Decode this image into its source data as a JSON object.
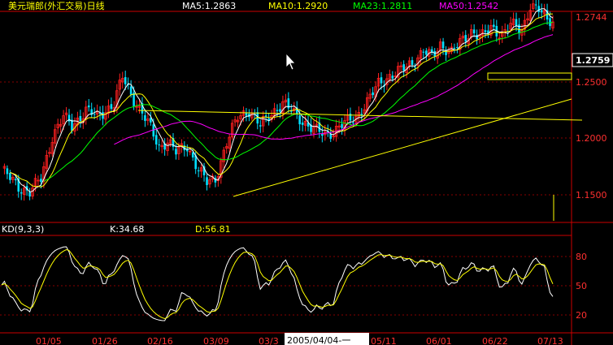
{
  "header": {
    "title": "美元瑞郎(外汇交易)日线",
    "ma_labels": [
      {
        "text": "MA5:1.2863",
        "color": "#ffffff"
      },
      {
        "text": "MA10:1.2920",
        "color": "#ffff00"
      },
      {
        "text": "MA23:1.2811",
        "color": "#00ff00"
      },
      {
        "text": "MA50:1.2542",
        "color": "#ff00ff"
      }
    ]
  },
  "price_axis": {
    "labels": [
      "1.2744",
      "1.2500",
      "1.2000",
      "1.1500"
    ],
    "current": "1.2759"
  },
  "indicator": {
    "name": "KD(9,3,3)",
    "k_label": "K:34.68",
    "d_label": "D:56.81",
    "axis_labels": [
      "80",
      "50",
      "20"
    ]
  },
  "date_axis": {
    "labels": [
      "01/05",
      "01/26",
      "02/16",
      "03/09",
      "03/3",
      "05/11",
      "06/01",
      "06/22",
      "07/13"
    ],
    "cursor_label": "2005/04/04-一"
  },
  "chart_data": {
    "type": "candlestick",
    "title": "美元瑞郎(外汇交易)日线",
    "price_range": [
      1.13,
      1.285
    ],
    "price_ticks": [
      1.15,
      1.2,
      1.25,
      1.2744
    ],
    "last_price": 1.2759,
    "moving_averages": [
      {
        "name": "MA5",
        "value": 1.2863,
        "color": "#ffffff"
      },
      {
        "name": "MA10",
        "value": 1.292,
        "color": "#ffff00"
      },
      {
        "name": "MA23",
        "value": 1.2811,
        "color": "#00ff00"
      },
      {
        "name": "MA50",
        "value": 1.2542,
        "color": "#ff00ff"
      }
    ],
    "kd": {
      "K": 34.68,
      "D": 56.81,
      "levels": [
        80,
        50,
        20
      ]
    },
    "date_ticks": [
      "01/05",
      "01/26",
      "02/16",
      "03/09",
      "03/3",
      "05/11",
      "06/01",
      "06/22",
      "07/13"
    ],
    "colors": {
      "up": "#ff2020",
      "down": "#00e0ff",
      "grid": "#880000",
      "border": "#cc0000",
      "trend": "#ffff00"
    }
  }
}
